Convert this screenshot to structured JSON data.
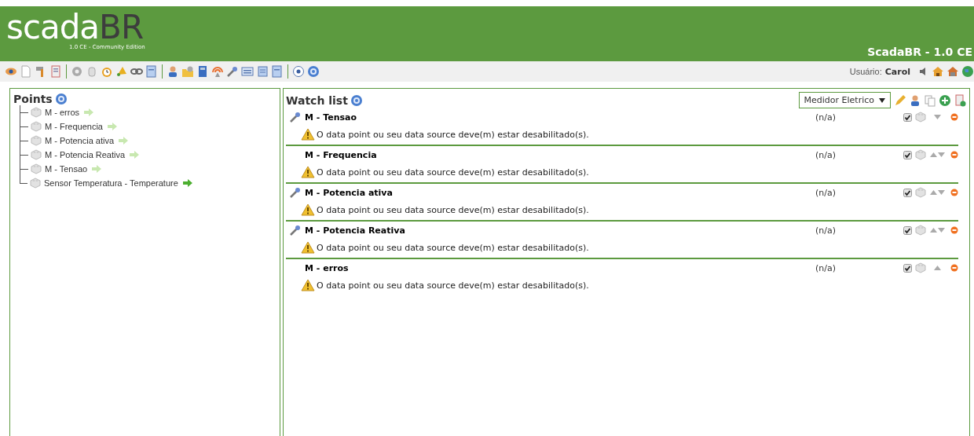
{
  "header": {
    "logo_main": "scada",
    "logo_accent": "BR",
    "edition": "1.0 CE - Community Edition",
    "title": "ScadaBR - 1.0 CE"
  },
  "toolbar": {
    "user_label": "Usuário:",
    "user_name": "Carol"
  },
  "points": {
    "title": "Points",
    "items": [
      {
        "name": "M - erros",
        "enabled": false
      },
      {
        "name": "M - Frequencia",
        "enabled": false
      },
      {
        "name": "M - Potencia ativa",
        "enabled": false
      },
      {
        "name": "M - Potencia Reativa",
        "enabled": false
      },
      {
        "name": "M - Tensao",
        "enabled": false
      },
      {
        "name": "Sensor Temperatura - Temperature",
        "enabled": true
      }
    ]
  },
  "watch_list": {
    "title": "Watch list",
    "selected_list": "Medidor Eletrico",
    "rows": [
      {
        "name": "M - Tensao",
        "settable": true,
        "value": "(n/a)",
        "checked": true,
        "can_move_up": false,
        "can_move_down": true,
        "message": "O data point ou seu data source deve(m) estar desabilitado(s)."
      },
      {
        "name": "M - Frequencia",
        "settable": false,
        "value": "(n/a)",
        "checked": true,
        "can_move_up": true,
        "can_move_down": true,
        "message": "O data point ou seu data source deve(m) estar desabilitado(s)."
      },
      {
        "name": "M - Potencia ativa",
        "settable": true,
        "value": "(n/a)",
        "checked": true,
        "can_move_up": true,
        "can_move_down": true,
        "message": "O data point ou seu data source deve(m) estar desabilitado(s)."
      },
      {
        "name": "M - Potencia Reativa",
        "settable": true,
        "value": "(n/a)",
        "checked": true,
        "can_move_up": true,
        "can_move_down": true,
        "message": "O data point ou seu data source deve(m) estar desabilitado(s)."
      },
      {
        "name": "M - erros",
        "settable": false,
        "value": "(n/a)",
        "checked": true,
        "can_move_up": true,
        "can_move_down": false,
        "message": "O data point ou seu data source deve(m) estar desabilitado(s)."
      }
    ]
  }
}
